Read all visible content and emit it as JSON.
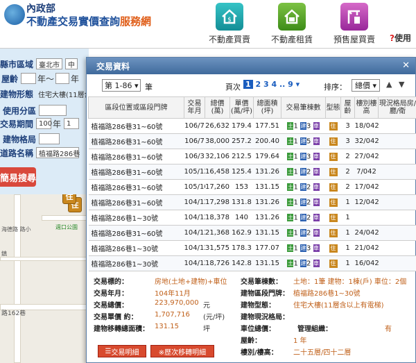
{
  "header": {
    "ministry": "內政部",
    "title_main": "不動產交易實價查詢",
    "title_highlight": "服務網",
    "nav": [
      {
        "label": "不動產買賣"
      },
      {
        "label": "不動產租賃"
      },
      {
        "label": "預售屋買賣"
      }
    ],
    "help": "使用"
  },
  "search": {
    "county_label": "縣市區域",
    "county_value": "臺北市",
    "district_value": "中",
    "age_label": "屋齡",
    "age_from_unit": "年～",
    "age_to_unit": "年",
    "type_label": "建物形態",
    "type_value": "住宅大樓(11層含以",
    "zone_label": "使用分區",
    "period_label": "交易期間",
    "period_year": "100",
    "period_unit": "年",
    "period_month": "1",
    "layout_label": "建物格局",
    "road_label": "道路名稱",
    "road_value": "植福路286巷",
    "quick_search": "簡易搜尋"
  },
  "map": {
    "road_name": "路162巷",
    "school": "海德路 路小",
    "park": "週口公園",
    "lane": "鎮"
  },
  "dialog": {
    "title": "交易資料",
    "close": "✕",
    "range": "第 1-86 ▾",
    "range_unit": "筆",
    "page_label": "頁次",
    "pages_current": "1",
    "pages_rest": "2 3 4 .. 9 ▾",
    "sort_label": "排序：",
    "sort_value": "總價 ▾",
    "sort_up": "▲",
    "sort_down": "▼",
    "columns": [
      "區段位置或區段門牌",
      "交易年月",
      "總價(萬)",
      "單價(萬/坪)",
      "總面積(坪)",
      "交易筆棟數",
      "型態",
      "屋齡",
      "樓別樓高",
      "現況格局房/廳/衛"
    ],
    "rows": [
      {
        "addr": "植福路286巷31~60號",
        "ym": "106/7",
        "total": "26,632",
        "unit": "179.4",
        "area": "177.51",
        "b": "3",
        "age": "3",
        "floor": "18/042"
      },
      {
        "addr": "植福路286巷31~60號",
        "ym": "106/7",
        "total": "38,000",
        "unit": "257.2",
        "area": "200.40",
        "b": "5",
        "age": "3",
        "floor": "32/042"
      },
      {
        "addr": "植福路286巷31~60號",
        "ym": "106/3",
        "total": "32,106",
        "unit": "212.5",
        "area": "179.64",
        "b": "3",
        "age": "2",
        "floor": "27/042"
      },
      {
        "addr": "植福路286巷31~60號",
        "ym": "105/12",
        "total": "16,458",
        "unit": "125.4",
        "area": "131.26",
        "b": "2",
        "age": "2",
        "floor": "7/042"
      },
      {
        "addr": "植福路286巷31~60號",
        "ym": "105/10",
        "total": "17,260",
        "unit": "153",
        "area": "131.15",
        "b": "2",
        "age": "2",
        "floor": "17/042"
      },
      {
        "addr": "植福路286巷31~60號",
        "ym": "104/12",
        "total": "17,298",
        "unit": "131.8",
        "area": "131.26",
        "b": "2",
        "age": "1",
        "floor": "12/042"
      },
      {
        "addr": "植福路286巷1~30號",
        "ym": "104/12",
        "total": "18,378",
        "unit": "140",
        "area": "131.26",
        "b": "2",
        "age": "1",
        "floor": ""
      },
      {
        "addr": "植福路286巷31~60號",
        "ym": "104/12",
        "total": "21,368",
        "unit": "162.9",
        "area": "131.15",
        "b": "2",
        "age": "1",
        "floor": "24/042"
      },
      {
        "addr": "植福路286巷1~30號",
        "ym": "104/12",
        "total": "31,575",
        "unit": "178.3",
        "area": "177.07",
        "b": "3",
        "age": "1",
        "floor": "21/042"
      },
      {
        "addr": "植福路286巷1~30號",
        "ym": "104/12",
        "total": "18,726",
        "unit": "142.8",
        "area": "131.15",
        "b": "2",
        "age": "1",
        "floor": "16/042"
      }
    ],
    "row_land": "1",
    "row_bldg": "1",
    "row_park": "1",
    "row_type": "住"
  },
  "detail": {
    "k1": "交易標的：",
    "v1": "房地(土地+建物)+車位",
    "k2": "交易年月：",
    "v2": "104年11月",
    "k3": "交易總價：",
    "v3": "223,970,000",
    "u3": "元",
    "k4": "交易單價 約：",
    "v4": "1,707,716",
    "u4": "(元/坪)",
    "k5": "建物移轉總面積：",
    "v5": "131.15",
    "u5": "坪",
    "k6": "交易筆棟數：",
    "v6": "土地：1筆 建物：1棟(戶) 車位：2個",
    "k7": "建物區段門牌：",
    "v7": "植福路286巷1~30號",
    "k8": "建物型態：",
    "v8": "住宅大樓(11層含以上有電梯)",
    "k9": "建物現況格局：",
    "k10": "車位總價：",
    "k10b": "管理組織：",
    "v10b": "有",
    "k11": "屋齡：",
    "v11": "1 年",
    "k12": "樓別/樓高：",
    "v12": "二十五層/四十二層",
    "btn_detail": "交易明細",
    "btn_history": "※歷次移轉明細"
  }
}
